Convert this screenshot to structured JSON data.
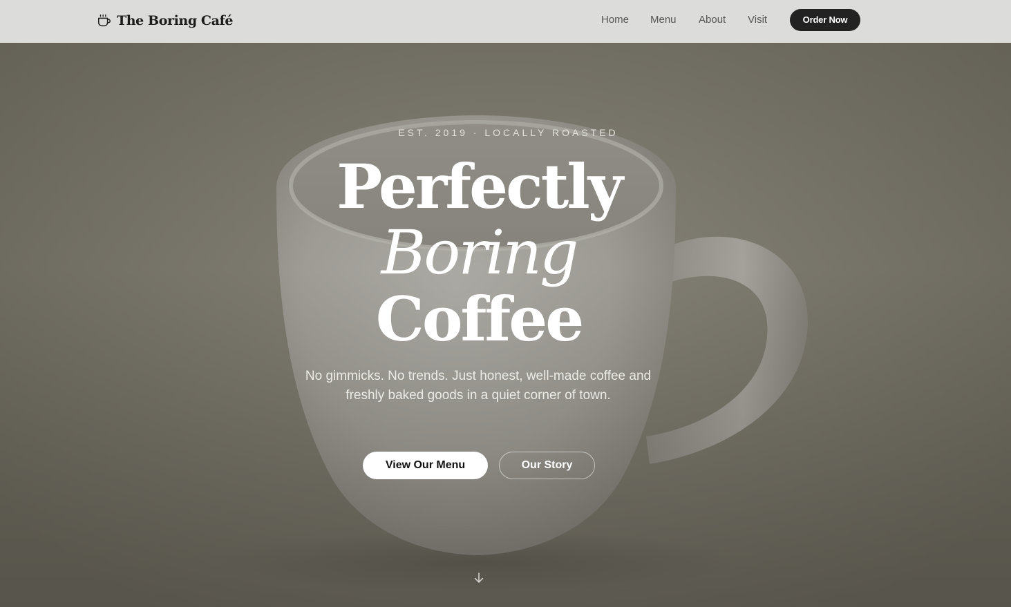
{
  "nav": {
    "brand": "The Boring Café",
    "brand_icon": "coffee-cup-icon",
    "links": [
      "Home",
      "Menu",
      "About",
      "Visit"
    ],
    "cta": "Order Now"
  },
  "hero": {
    "eyebrow": "EST. 2019 · LOCALLY ROASTED",
    "headline": [
      "Perfectly",
      "Boring",
      "Coffee"
    ],
    "subhead": "No gimmicks. No trends. Just honest, well-made coffee and freshly baked goods in a quiet corner of town.",
    "primary_button": "View Our Menu",
    "secondary_button": "Our Story",
    "scroll_icon": "arrow-down-icon"
  },
  "colors": {
    "nav_background": "#dcdcda",
    "cta_background": "#222222",
    "hero_overlay": "#7a776c"
  }
}
